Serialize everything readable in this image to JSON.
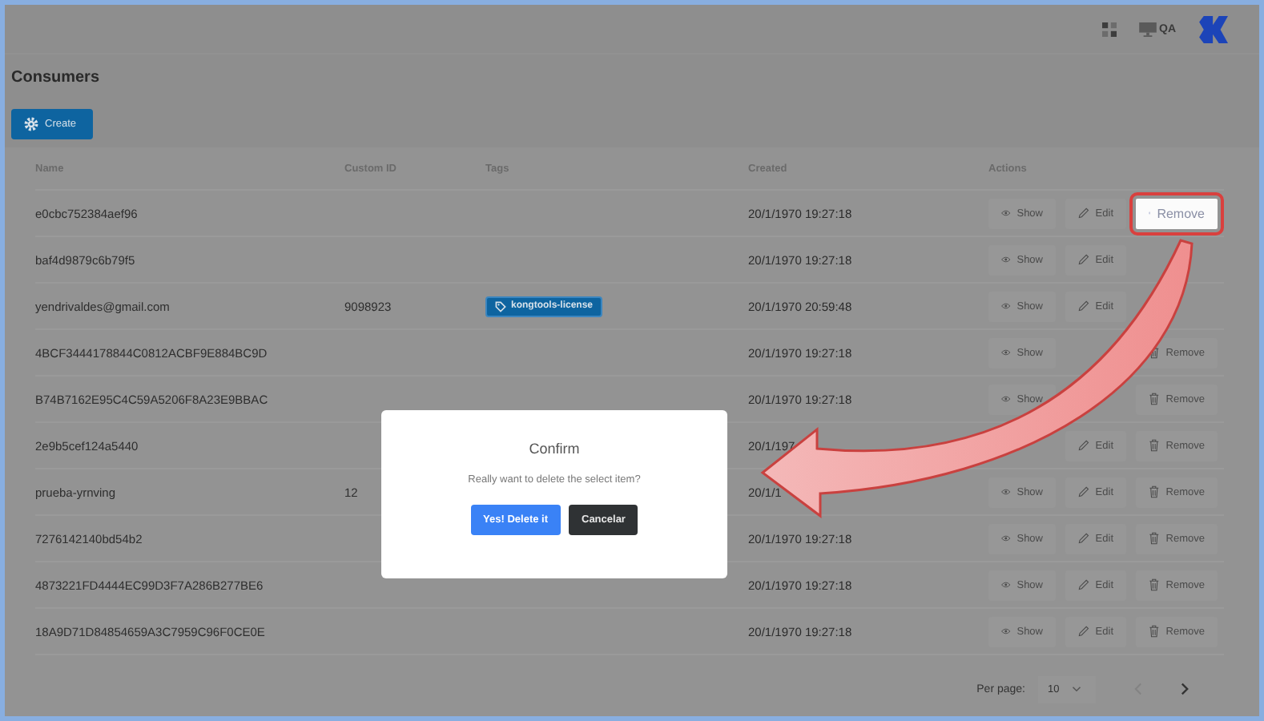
{
  "topbar": {
    "environment": "QA"
  },
  "page": {
    "title": "Consumers",
    "create_button": "Create"
  },
  "table": {
    "columns": [
      "Name",
      "Custom ID",
      "Tags",
      "Created",
      "Actions"
    ],
    "rows": [
      {
        "name": "e0cbc752384aef96",
        "custom_id": "",
        "tags": [],
        "created": "20/1/1970 19:27:18",
        "actions": [
          {
            "kind": "show",
            "label": "Show",
            "highlighted": false
          },
          {
            "kind": "edit",
            "label": "Edit",
            "highlighted": false
          },
          {
            "kind": "remove",
            "label": "Remove",
            "highlighted": true
          }
        ]
      },
      {
        "name": "baf4d9879c6b79f5",
        "custom_id": "",
        "tags": [],
        "created": "20/1/1970 19:27:18",
        "actions": [
          {
            "kind": "show",
            "label": "Show",
            "highlighted": false
          },
          {
            "kind": "edit",
            "label": "Edit",
            "highlighted": false
          }
        ]
      },
      {
        "name": "yendrivaldes@gmail.com",
        "custom_id": "9098923",
        "tags": [
          "kongtools-license"
        ],
        "created": "20/1/1970 20:59:48",
        "actions": [
          {
            "kind": "show",
            "label": "Show",
            "highlighted": false
          },
          {
            "kind": "edit",
            "label": "Edit",
            "highlighted": false
          }
        ]
      },
      {
        "name": "4BCF3444178844C0812ACBF9E884BC9D",
        "custom_id": "",
        "tags": [],
        "created": "20/1/1970 19:27:18",
        "actions": [
          {
            "kind": "show",
            "label": "Show",
            "highlighted": false
          },
          {
            "kind": "remove",
            "label": "Remove",
            "highlighted": false
          }
        ]
      },
      {
        "name": "B74B7162E95C4C59A5206F8A23E9BBAC",
        "custom_id": "",
        "tags": [],
        "created": "20/1/1970 19:27:18",
        "actions": [
          {
            "kind": "show",
            "label": "Show",
            "highlighted": false
          },
          {
            "kind": "remove",
            "label": "Remove",
            "highlighted": false
          }
        ]
      },
      {
        "name": "2e9b5cef124a5440",
        "custom_id": "",
        "tags": [],
        "created": "20/1/197",
        "actions": [
          {
            "kind": "edit",
            "label": "Edit",
            "highlighted": false
          },
          {
            "kind": "remove",
            "label": "Remove",
            "highlighted": false
          }
        ]
      },
      {
        "name": "prueba-yrnving",
        "custom_id": "12",
        "tags": [],
        "created": "20/1/1",
        "actions": [
          {
            "kind": "show",
            "label": "Show",
            "highlighted": false
          },
          {
            "kind": "edit",
            "label": "Edit",
            "highlighted": false
          },
          {
            "kind": "remove",
            "label": "Remove",
            "highlighted": false
          }
        ]
      },
      {
        "name": "7276142140bd54b2",
        "custom_id": "",
        "tags": [],
        "created": "20/1/1970 19:27:18",
        "actions": [
          {
            "kind": "show",
            "label": "Show",
            "highlighted": false
          },
          {
            "kind": "edit",
            "label": "Edit",
            "highlighted": false
          },
          {
            "kind": "remove",
            "label": "Remove",
            "highlighted": false
          }
        ]
      },
      {
        "name": "4873221FD4444EC99D3F7A286B277BE6",
        "custom_id": "",
        "tags": [],
        "created": "20/1/1970 19:27:18",
        "actions": [
          {
            "kind": "show",
            "label": "Show",
            "highlighted": false
          },
          {
            "kind": "edit",
            "label": "Edit",
            "highlighted": false
          },
          {
            "kind": "remove",
            "label": "Remove",
            "highlighted": false
          }
        ]
      },
      {
        "name": "18A9D71D84854659A3C7959C96F0CE0E",
        "custom_id": "",
        "tags": [],
        "created": "20/1/1970 19:27:18",
        "actions": [
          {
            "kind": "show",
            "label": "Show",
            "highlighted": false
          },
          {
            "kind": "edit",
            "label": "Edit",
            "highlighted": false
          },
          {
            "kind": "remove",
            "label": "Remove",
            "highlighted": false
          }
        ]
      }
    ]
  },
  "pagination": {
    "label": "Per page:",
    "page_size": "10"
  },
  "dialog": {
    "title": "Confirm",
    "message": "Really want to delete the select item?",
    "buttons": [
      {
        "label": "Yes! Delete it",
        "kind": "primary"
      },
      {
        "label": "Cancelar",
        "kind": "dark"
      }
    ]
  }
}
